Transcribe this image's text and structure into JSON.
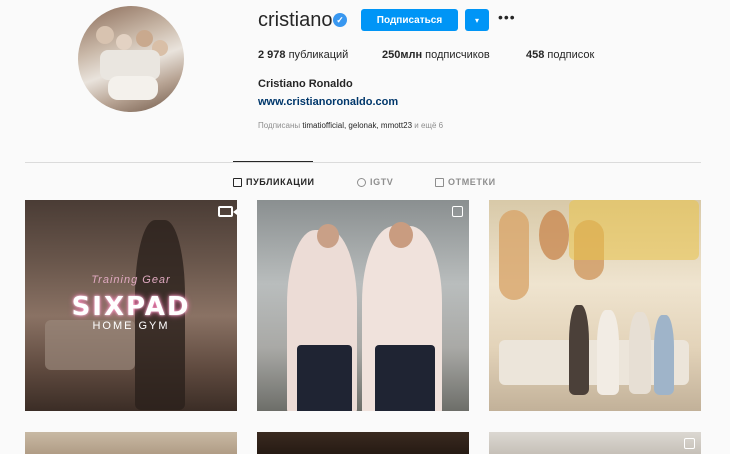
{
  "profile": {
    "username": "cristiano",
    "verified_badge": "✓",
    "follow_label": "Подписаться",
    "dropdown_glyph": "▾",
    "more_glyph": "•••",
    "full_name": "Cristiano Ronaldo",
    "website": "www.cristianoronaldo.com"
  },
  "stats": {
    "posts_count": "2 978",
    "posts_label": " публикаций",
    "followers_count": "250млн",
    "followers_label": " подписчиков",
    "following_count": "458",
    "following_label": " подписок"
  },
  "followed_by": {
    "prefix": "Подписаны ",
    "names": "timatiofficial, gelonak, mmott23",
    "suffix": " и ещё 6"
  },
  "tabs": [
    {
      "label": "ПУБЛИКАЦИИ",
      "icon": "grid-icon"
    },
    {
      "label": "IGTV",
      "icon": "igtv-icon"
    },
    {
      "label": "ОТМЕТКИ",
      "icon": "tagged-icon"
    }
  ],
  "posts": {
    "sixpad_subtitle": "Training Gear",
    "sixpad_title": "SIXPAD",
    "sixpad_home": "HOME GYM"
  },
  "colors": {
    "accent": "#0095f6",
    "verified": "#3897f0",
    "link": "#00376b"
  }
}
